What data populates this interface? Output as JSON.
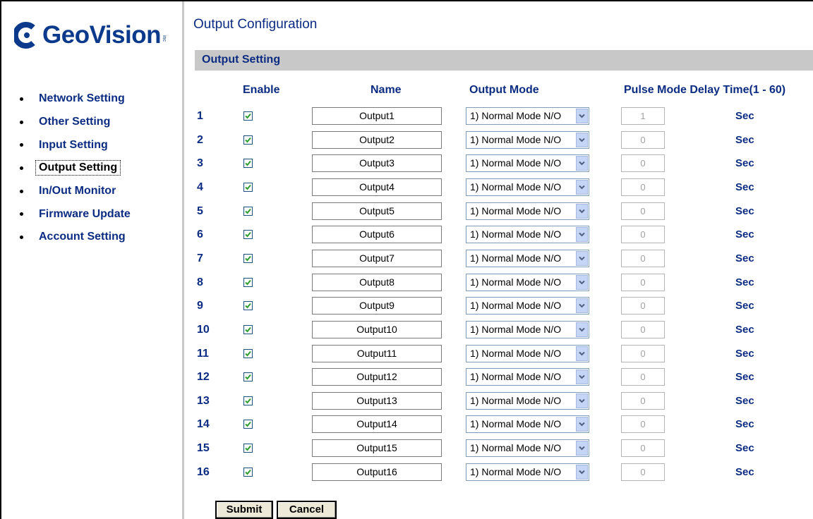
{
  "brand": {
    "name": "GeoVision",
    "inc": "inc"
  },
  "sidebar": {
    "items": [
      {
        "label": "Network Setting",
        "active": false
      },
      {
        "label": "Other Setting",
        "active": false
      },
      {
        "label": "Input Setting",
        "active": false
      },
      {
        "label": "Output Setting",
        "active": true
      },
      {
        "label": "In/Out Monitor",
        "active": false
      },
      {
        "label": "Firmware Update",
        "active": false
      },
      {
        "label": "Account Setting",
        "active": false
      }
    ]
  },
  "main": {
    "title": "Output Configuration",
    "section_title": "Output Setting",
    "headers": {
      "enable": "Enable",
      "name": "Name",
      "mode": "Output Mode",
      "delay": "Pulse Mode Delay Time(1 - 60)"
    },
    "rows": [
      {
        "num": "1",
        "enabled": true,
        "name": "Output1",
        "mode": "1) Normal Mode N/O",
        "delay": "1",
        "unit": "Sec"
      },
      {
        "num": "2",
        "enabled": true,
        "name": "Output2",
        "mode": "1) Normal Mode N/O",
        "delay": "0",
        "unit": "Sec"
      },
      {
        "num": "3",
        "enabled": true,
        "name": "Output3",
        "mode": "1) Normal Mode N/O",
        "delay": "0",
        "unit": "Sec"
      },
      {
        "num": "4",
        "enabled": true,
        "name": "Output4",
        "mode": "1) Normal Mode N/O",
        "delay": "0",
        "unit": "Sec"
      },
      {
        "num": "5",
        "enabled": true,
        "name": "Output5",
        "mode": "1) Normal Mode N/O",
        "delay": "0",
        "unit": "Sec"
      },
      {
        "num": "6",
        "enabled": true,
        "name": "Output6",
        "mode": "1) Normal Mode N/O",
        "delay": "0",
        "unit": "Sec"
      },
      {
        "num": "7",
        "enabled": true,
        "name": "Output7",
        "mode": "1) Normal Mode N/O",
        "delay": "0",
        "unit": "Sec"
      },
      {
        "num": "8",
        "enabled": true,
        "name": "Output8",
        "mode": "1) Normal Mode N/O",
        "delay": "0",
        "unit": "Sec"
      },
      {
        "num": "9",
        "enabled": true,
        "name": "Output9",
        "mode": "1) Normal Mode N/O",
        "delay": "0",
        "unit": "Sec"
      },
      {
        "num": "10",
        "enabled": true,
        "name": "Output10",
        "mode": "1) Normal Mode N/O",
        "delay": "0",
        "unit": "Sec"
      },
      {
        "num": "11",
        "enabled": true,
        "name": "Output11",
        "mode": "1) Normal Mode N/O",
        "delay": "0",
        "unit": "Sec"
      },
      {
        "num": "12",
        "enabled": true,
        "name": "Output12",
        "mode": "1) Normal Mode N/O",
        "delay": "0",
        "unit": "Sec"
      },
      {
        "num": "13",
        "enabled": true,
        "name": "Output13",
        "mode": "1) Normal Mode N/O",
        "delay": "0",
        "unit": "Sec"
      },
      {
        "num": "14",
        "enabled": true,
        "name": "Output14",
        "mode": "1) Normal Mode N/O",
        "delay": "0",
        "unit": "Sec"
      },
      {
        "num": "15",
        "enabled": true,
        "name": "Output15",
        "mode": "1) Normal Mode N/O",
        "delay": "0",
        "unit": "Sec"
      },
      {
        "num": "16",
        "enabled": true,
        "name": "Output16",
        "mode": "1) Normal Mode N/O",
        "delay": "0",
        "unit": "Sec"
      }
    ],
    "buttons": {
      "submit": "Submit",
      "cancel": "Cancel"
    }
  },
  "colors": {
    "label_blue": "#0b2c82",
    "section_gray": "#c8c8c8",
    "check_green": "#2e9e2e"
  }
}
